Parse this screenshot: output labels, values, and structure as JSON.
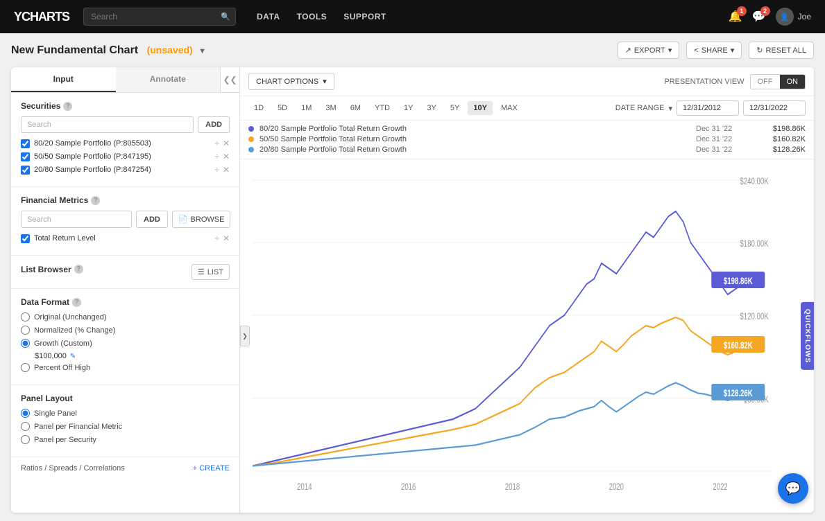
{
  "topnav": {
    "logo_y": "Y",
    "logo_text": "CHARTS",
    "search_placeholder": "Search",
    "links": [
      "DATA",
      "TOOLS",
      "SUPPORT"
    ],
    "notifications_count": "1",
    "messages_count": "2",
    "user_name": "Joe"
  },
  "page": {
    "title": "New Fundamental Chart",
    "unsaved": "(unsaved)",
    "actions": {
      "export": "EXPORT",
      "share": "SHARE",
      "reset": "RESET ALL"
    }
  },
  "sidebar": {
    "tabs": {
      "input": "Input",
      "annotate": "Annotate"
    },
    "securities": {
      "title": "Securities",
      "help": "?",
      "search_placeholder": "Search",
      "add_btn": "ADD",
      "items": [
        {
          "id": "p805503",
          "name": "80/20 Sample Portfolio (P:805503)",
          "checked": true,
          "color": "#5b5bd6"
        },
        {
          "id": "p847195",
          "name": "50/50 Sample Portfolio (P:847195)",
          "checked": true,
          "color": "#f5a623"
        },
        {
          "id": "p847254",
          "name": "20/80 Sample Portfolio (P:847254)",
          "checked": true,
          "color": "#5b9bd5"
        }
      ]
    },
    "financial_metrics": {
      "title": "Financial Metrics",
      "help": "?",
      "search_placeholder": "Search",
      "add_btn": "ADD",
      "browse_btn": "BROWSE",
      "items": [
        {
          "name": "Total Return Level",
          "checked": true
        }
      ]
    },
    "list_browser": {
      "title": "List Browser",
      "help": "?",
      "list_btn": "LIST"
    },
    "data_format": {
      "title": "Data Format",
      "help": "?",
      "options": [
        {
          "label": "Original (Unchanged)",
          "value": "original",
          "checked": false
        },
        {
          "label": "Normalized (% Change)",
          "value": "normalized",
          "checked": false
        },
        {
          "label": "Growth (Custom)",
          "value": "growth",
          "checked": true
        },
        {
          "label": "Percent Off High",
          "value": "pct_off_high",
          "checked": false
        }
      ],
      "custom_value": "$100,000"
    },
    "panel_layout": {
      "title": "Panel Layout",
      "options": [
        {
          "label": "Single Panel",
          "value": "single",
          "checked": true
        },
        {
          "label": "Panel per Financial Metric",
          "value": "per_metric",
          "checked": false
        },
        {
          "label": "Panel per Security",
          "value": "per_security",
          "checked": false
        }
      ]
    },
    "ratios": {
      "title": "Ratios / Spreads / Correlations",
      "create_btn": "+ CREATE"
    }
  },
  "chart": {
    "options_label": "CHART OPTIONS",
    "presentation_label": "PRESENTATION VIEW",
    "toggle_off": "OFF",
    "toggle_on": "ON",
    "time_buttons": [
      "1D",
      "5D",
      "1M",
      "3M",
      "6M",
      "YTD",
      "1Y",
      "3Y",
      "5Y",
      "10Y",
      "MAX"
    ],
    "date_range_label": "DATE RANGE",
    "date_start": "12/31/2012",
    "date_end": "12/31/2022",
    "legend": [
      {
        "label": "80/20 Sample Portfolio Total Return Growth",
        "date": "Dec 31 '22",
        "value": "$198.86K",
        "color": "#5b5bd6"
      },
      {
        "label": "50/50 Sample Portfolio Total Return Growth",
        "date": "Dec 31 '22",
        "value": "$160.82K",
        "color": "#f5a623"
      },
      {
        "label": "20/80 Sample Portfolio Total Return Growth",
        "date": "Dec 31 '22",
        "value": "$128.26K",
        "color": "#5b9bd5"
      }
    ],
    "y_axis": {
      "labels": [
        "$240.00K",
        "$180.00K",
        "$120.00K",
        "$60.00K"
      ]
    },
    "x_axis": {
      "labels": [
        "2014",
        "2016",
        "2018",
        "2020",
        "2022"
      ]
    },
    "end_labels": [
      {
        "value": "$198.86K",
        "color": "#5b5bd6"
      },
      {
        "value": "$160.82K",
        "color": "#f5a623"
      },
      {
        "value": "$128.26K",
        "color": "#5b9bd5"
      }
    ],
    "quickflows": "QUICKFLOWS"
  }
}
